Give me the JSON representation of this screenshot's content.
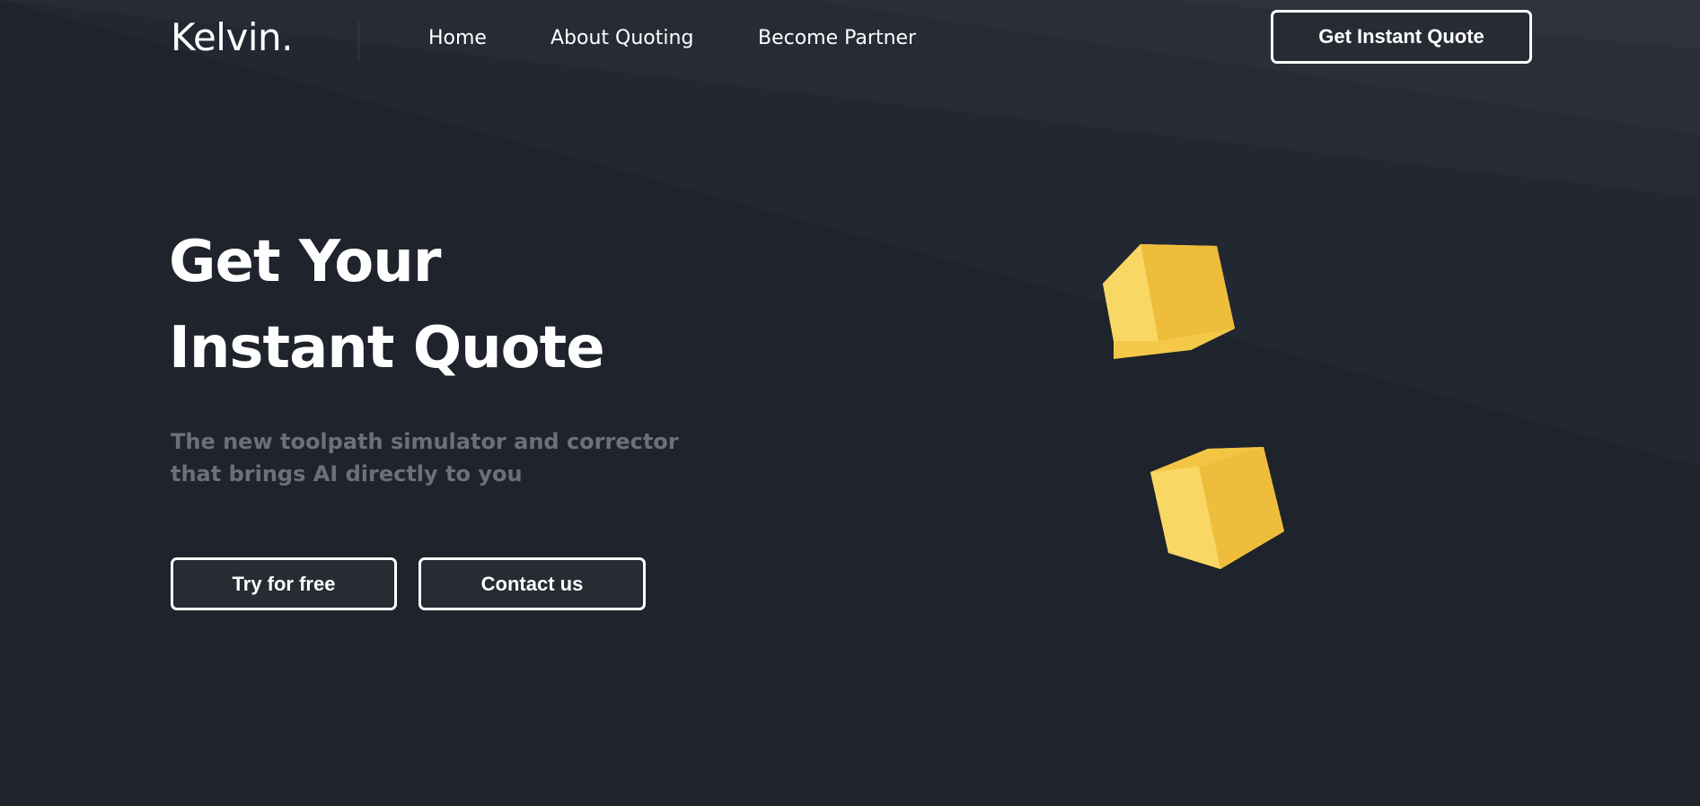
{
  "header": {
    "logo": "Kelvin.",
    "nav": [
      "Home",
      "About Quoting",
      "Become Partner"
    ],
    "cta_label": "Get Instant Quote"
  },
  "hero": {
    "title_line1": "Get Your",
    "title_line2": "Instant Quote",
    "subtitle_line1": "The new toolpath simulator and corrector",
    "subtitle_line2": "that brings AI directly to you",
    "primary_button": "Try for free",
    "secondary_button": "Contact us"
  },
  "colors": {
    "background": "#1f232b",
    "accent": "#f0c03c",
    "subtitle": "#6b7079",
    "button_fill": "#272b33"
  },
  "decorations": [
    "cube-icon",
    "cube-icon"
  ]
}
